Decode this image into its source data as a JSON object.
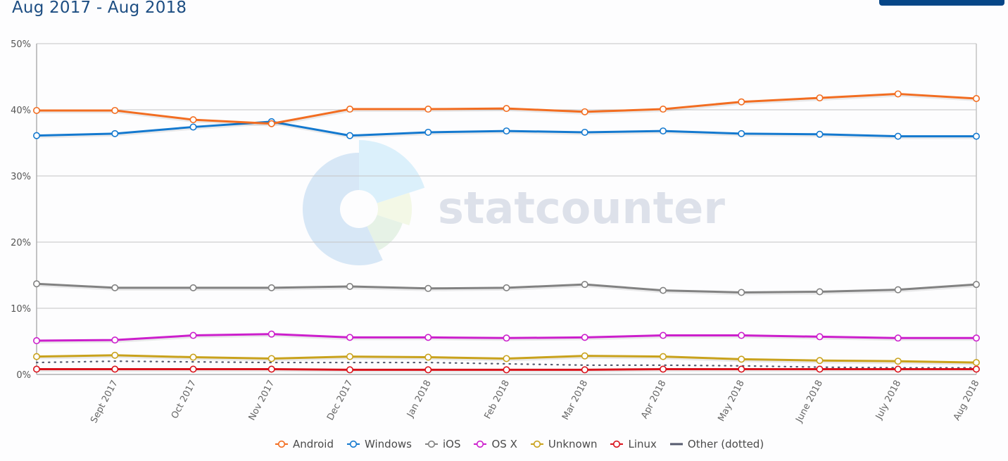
{
  "header": {
    "title": "Aug 2017 - Aug 2018"
  },
  "chart_data": {
    "type": "line",
    "title": "Aug 2017 - Aug 2018",
    "xlabel": "",
    "ylabel": "",
    "ylim": [
      0,
      50
    ],
    "yticks": [
      "0%",
      "10%",
      "20%",
      "30%",
      "40%",
      "50%"
    ],
    "yticks_values": [
      0,
      10,
      20,
      30,
      40,
      50
    ],
    "grid": true,
    "legend_position": "bottom",
    "watermark": "statcounter",
    "categories": [
      "Aug 2017",
      "Sept 2017",
      "Oct 2017",
      "Nov 2017",
      "Dec 2017",
      "Jan 2018",
      "Feb 2018",
      "Mar 2018",
      "Apr 2018",
      "May 2018",
      "June 2018",
      "July 2018",
      "Aug 2018"
    ],
    "x_tick_labels": [
      "",
      "Sept 2017",
      "Oct 2017",
      "Nov 2017",
      "Dec 2017",
      "Jan 2018",
      "Feb 2018",
      "Mar 2018",
      "Apr 2018",
      "May 2018",
      "June 2018",
      "July 2018",
      "Aug 2018"
    ],
    "series": [
      {
        "name": "Android",
        "color": "#f26d21",
        "style": "solid",
        "values": [
          39.9,
          39.9,
          38.5,
          37.9,
          40.1,
          40.1,
          40.2,
          39.7,
          40.1,
          41.2,
          41.8,
          42.4,
          41.7
        ]
      },
      {
        "name": "Windows",
        "color": "#1479cf",
        "style": "solid",
        "values": [
          36.1,
          36.4,
          37.4,
          38.2,
          36.1,
          36.6,
          36.8,
          36.6,
          36.8,
          36.4,
          36.3,
          36.0,
          36.0
        ]
      },
      {
        "name": "iOS",
        "color": "#828282",
        "style": "solid",
        "values": [
          13.7,
          13.1,
          13.1,
          13.1,
          13.3,
          13.0,
          13.1,
          13.6,
          12.7,
          12.4,
          12.5,
          12.8,
          13.6
        ]
      },
      {
        "name": "OS X",
        "color": "#cc1fcc",
        "style": "solid",
        "values": [
          5.1,
          5.2,
          5.9,
          6.1,
          5.6,
          5.6,
          5.5,
          5.6,
          5.9,
          5.9,
          5.7,
          5.5,
          5.5
        ]
      },
      {
        "name": "Unknown",
        "color": "#c9a21c",
        "style": "solid",
        "values": [
          2.7,
          2.9,
          2.6,
          2.4,
          2.7,
          2.6,
          2.4,
          2.8,
          2.7,
          2.3,
          2.1,
          2.0,
          1.8
        ]
      },
      {
        "name": "Linux",
        "color": "#d9121b",
        "style": "solid",
        "values": [
          0.8,
          0.8,
          0.8,
          0.8,
          0.7,
          0.7,
          0.7,
          0.7,
          0.8,
          0.8,
          0.8,
          0.8,
          0.8
        ]
      },
      {
        "name": "Other (dotted)",
        "color": "#555a6e",
        "style": "dotted",
        "values": [
          1.8,
          2.0,
          1.9,
          1.8,
          1.8,
          1.8,
          1.6,
          1.4,
          1.4,
          1.3,
          1.1,
          1.0,
          1.0
        ]
      }
    ]
  },
  "legend": {
    "items": [
      {
        "label": "Android",
        "color": "#f26d21",
        "marker": "circle"
      },
      {
        "label": "Windows",
        "color": "#1479cf",
        "marker": "circle"
      },
      {
        "label": "iOS",
        "color": "#828282",
        "marker": "circle"
      },
      {
        "label": "OS X",
        "color": "#cc1fcc",
        "marker": "circle"
      },
      {
        "label": "Unknown",
        "color": "#c9a21c",
        "marker": "circle"
      },
      {
        "label": "Linux",
        "color": "#d9121b",
        "marker": "circle"
      },
      {
        "label": "Other (dotted)",
        "color": "#555a6e",
        "marker": "dash"
      }
    ]
  }
}
